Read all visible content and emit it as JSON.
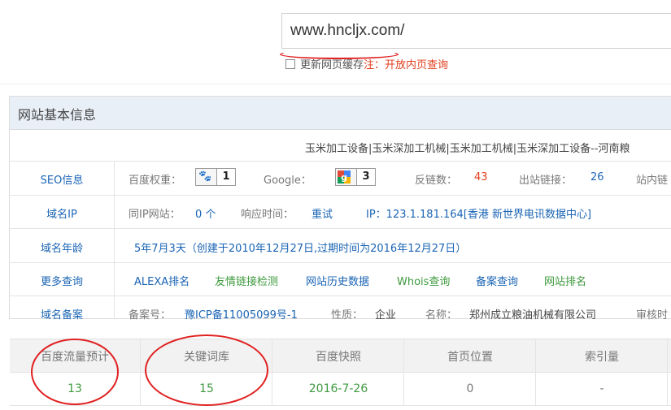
{
  "search": {
    "value": "www.hncljx.com/",
    "cache_label": "更新网页缓存",
    "note": "注：开放内页查询"
  },
  "panel": {
    "title": "网站基本信息",
    "site_title": "玉米加工设备|玉米深加工机械|玉米加工机械|玉米深加工设备--河南粮",
    "seo": {
      "label": "SEO信息",
      "baidu_label": "百度权重：",
      "baidu_value": "1",
      "google_label": "Google：",
      "google_value": "3",
      "backlinks_label": "反链数：",
      "backlinks_value": "43",
      "outlinks_label": "出站链接：",
      "outlinks_value": "26",
      "inlinks_label": "站内链"
    },
    "ip": {
      "label": "域名IP",
      "same_ip_label": "同IP网站：",
      "same_ip_value": "0 个",
      "response_label": "响应时间：",
      "retry_link": "重试",
      "ip_text": "IP：123.1.181.164[香港 新世界电讯数据中心]"
    },
    "age": {
      "label": "域名年龄",
      "value": "5年7月3天（创建于2010年12月27日,过期时间为2016年12月27日）"
    },
    "more": {
      "label": "更多查询",
      "links": [
        "ALEXA排名",
        "友情链接检测",
        "网站历史数据",
        "Whois查询",
        "备案查询",
        "网站排名"
      ]
    },
    "icp": {
      "label": "域名备案",
      "record_label": "备案号：",
      "record_value": "豫ICP备11005099号-1",
      "nature_label": "性质：",
      "nature_value": "企业",
      "name_label": "名称：",
      "name_value": "郑州成立粮油机械有限公司",
      "audit_label": "审核时"
    }
  },
  "stats": {
    "headers": [
      "百度流量预计",
      "关键词库",
      "百度快照",
      "首页位置",
      "索引量"
    ],
    "values": [
      "13",
      "15",
      "2016-7-26",
      "0",
      "-"
    ]
  },
  "colors": {
    "link_blue": "#1a64b4",
    "green": "#3e9a3e",
    "red_note": "#e23d1d",
    "header_bg": "#e9eff7",
    "annotation_red": "#e02020"
  }
}
